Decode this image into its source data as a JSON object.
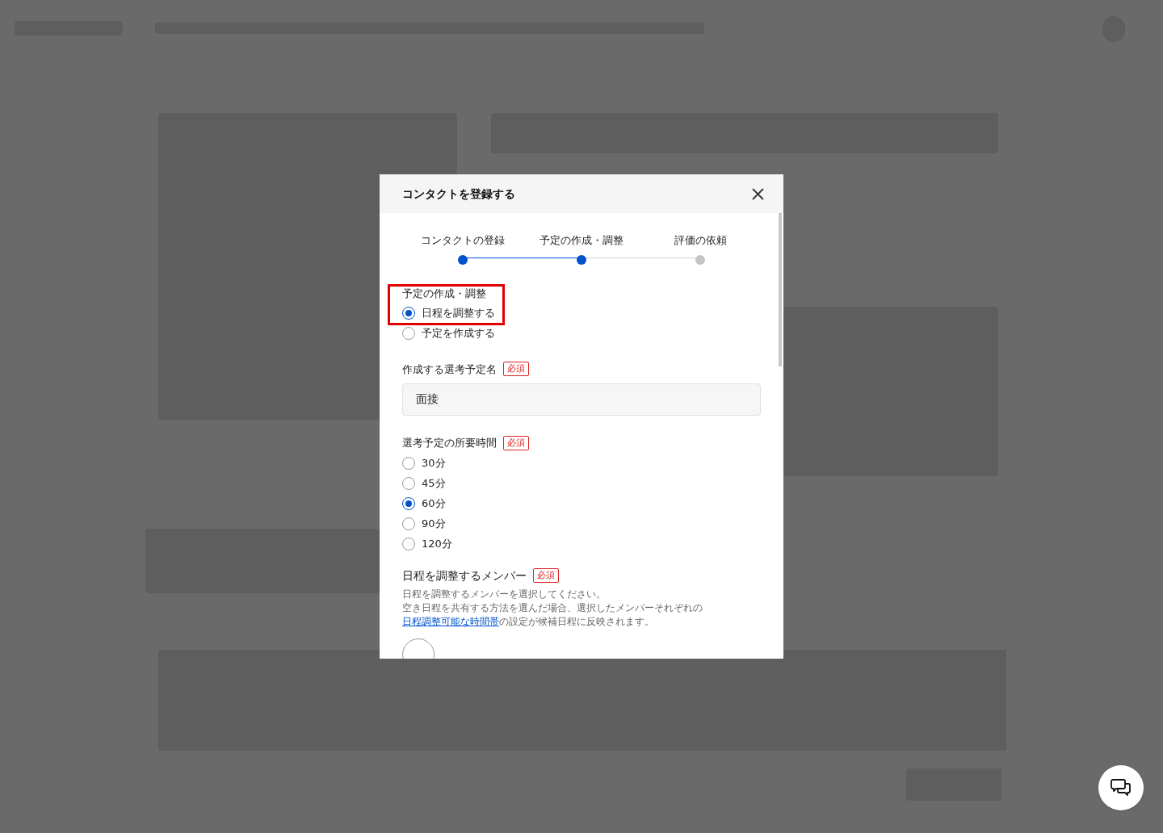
{
  "modal": {
    "title": "コンタクトを登録する",
    "steps": [
      {
        "label": "コンタクトの登録",
        "done": true
      },
      {
        "label": "予定の作成・調整",
        "done": true
      },
      {
        "label": "評価の依頼",
        "done": false
      }
    ],
    "mode": {
      "label": "予定の作成・調整",
      "options": [
        {
          "label": "日程を調整する",
          "selected": true,
          "highlight": true
        },
        {
          "label": "予定を作成する",
          "selected": false,
          "highlight": false
        }
      ]
    },
    "event_name": {
      "label": "作成する選考予定名",
      "required": "必須",
      "value": "面接"
    },
    "duration": {
      "label": "選考予定の所要時間",
      "required": "必須",
      "options": [
        {
          "label": "30分",
          "selected": false
        },
        {
          "label": "45分",
          "selected": false
        },
        {
          "label": "60分",
          "selected": true
        },
        {
          "label": "90分",
          "selected": false
        },
        {
          "label": "120分",
          "selected": false
        }
      ]
    },
    "members": {
      "label": "日程を調整するメンバー",
      "required": "必須",
      "help_1": "日程を調整するメンバーを選択してください。",
      "help_2": "空き日程を共有する方法を選んだ場合、選択したメンバーそれぞれの",
      "link": "日程調整可能な時間帯",
      "help_3": "の設定が候補日程に反映されます。"
    }
  }
}
